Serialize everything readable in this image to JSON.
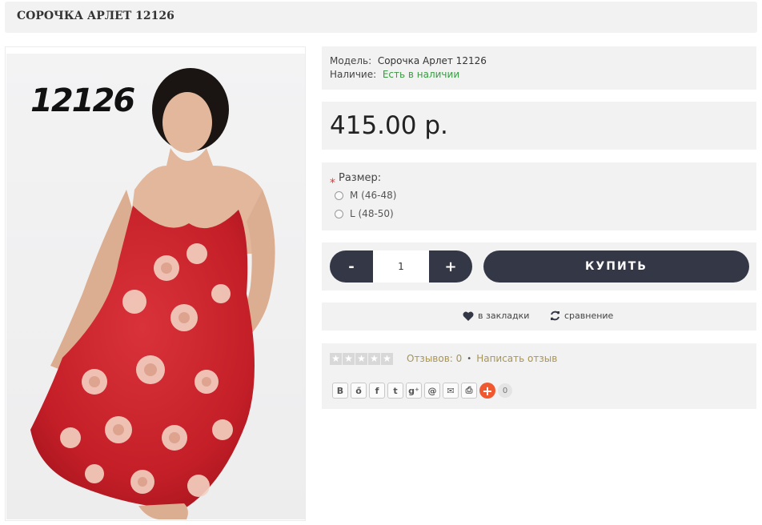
{
  "product": {
    "title": "СОРОЧКА АРЛЕТ 12126",
    "image_label": "12126",
    "model_label": "Модель:",
    "model_value": "Сорочка Арлет 12126",
    "stock_label": "Наличие:",
    "stock_value": "Есть в наличии",
    "price": "415.00 р."
  },
  "options": {
    "size_label": "Размер:",
    "required_mark": "*",
    "sizes": [
      {
        "label": "M (46-48)",
        "selected": false
      },
      {
        "label": "L (48-50)",
        "selected": false
      }
    ]
  },
  "cart": {
    "minus": "-",
    "plus": "+",
    "quantity": "1",
    "buy_label": "КУПИТЬ"
  },
  "actions": {
    "wishlist_label": "в закладки",
    "compare_label": "сравнение"
  },
  "reviews": {
    "rating": 0,
    "max_rating": 5,
    "reviews_link": "Отзывов: 0",
    "separator": "•",
    "write_link": "Написать отзыв"
  },
  "share": {
    "buttons": [
      {
        "icon": "vk-icon",
        "glyph": "В"
      },
      {
        "icon": "odnoklassniki-icon",
        "glyph": "ő"
      },
      {
        "icon": "facebook-icon",
        "glyph": "f"
      },
      {
        "icon": "twitter-icon",
        "glyph": "t"
      },
      {
        "icon": "google-plus-icon",
        "glyph": "g⁺"
      },
      {
        "icon": "mail-ru-icon",
        "glyph": "@"
      },
      {
        "icon": "email-icon",
        "glyph": "✉"
      },
      {
        "icon": "print-icon",
        "glyph": "⎙"
      }
    ],
    "more_glyph": "+",
    "count": "0"
  },
  "colors": {
    "panel_bg": "#f2f2f2",
    "button_dark": "#343745",
    "stock_green": "#3a9a43",
    "review_link": "#a89454",
    "required_red": "#e53935",
    "share_orange": "#f0582f",
    "dress_red": "#c8202a"
  }
}
